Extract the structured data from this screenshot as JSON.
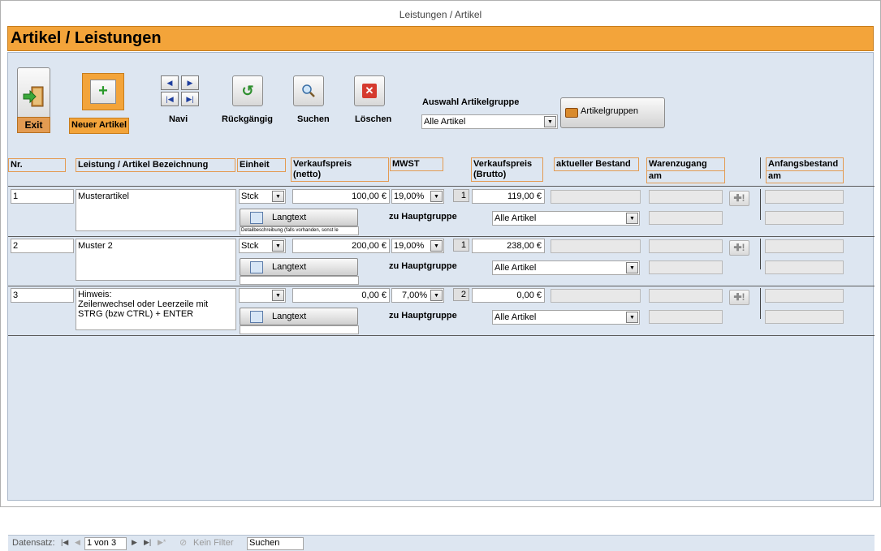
{
  "window_title": "Leistungen / Artikel",
  "header_title": "Artikel / Leistungen",
  "toolbar": {
    "exit": "Exit",
    "new": "Neuer Artikel",
    "navi": "Navi",
    "undo": "Rückgängig",
    "search": "Suchen",
    "delete": "Löschen",
    "group_label": "Auswahl Artikelgruppe",
    "group_value": "Alle Artikel",
    "groups_button": "Artikelgruppen"
  },
  "columns": {
    "nr": "Nr.",
    "name": "Leistung / Artikel Bezeichnung",
    "unit": "Einheit",
    "net1": "Verkaufspreis",
    "net2": "(netto)",
    "vat": "MWST",
    "gross1": "Verkaufspreis",
    "gross2": "(Brutto)",
    "stock": "aktueller Bestand",
    "receipt1": "Warenzugang",
    "receipt2": "am",
    "initial1": "Anfangsbestand",
    "initial2": "am"
  },
  "rows": [
    {
      "nr": "1",
      "name": "Musterartikel",
      "unit": "Stck",
      "net": "100,00 €",
      "vat": "19,00%",
      "vat_code": "1",
      "gross": "119,00 €",
      "langtext": "Langtext",
      "group_label": "zu Hauptgruppe",
      "group": "Alle Artikel",
      "hint": "Detailbeschreibung (falls vorhanden, sonst le"
    },
    {
      "nr": "2",
      "name": "Muster 2",
      "unit": "Stck",
      "net": "200,00 €",
      "vat": "19,00%",
      "vat_code": "1",
      "gross": "238,00 €",
      "langtext": "Langtext",
      "group_label": "zu Hauptgruppe",
      "group": "Alle Artikel",
      "hint": ""
    },
    {
      "nr": "3",
      "name": "Hinweis:\nZeilenwechsel oder Leerzeile mit\nSTRG (bzw CTRL) + ENTER",
      "unit": "",
      "net": "0,00 €",
      "vat": "7,00%",
      "vat_code": "2",
      "gross": "0,00 €",
      "langtext": "Langtext",
      "group_label": "zu Hauptgruppe",
      "group": "Alle Artikel",
      "hint": ""
    }
  ],
  "navbar": {
    "label": "Datensatz:",
    "position": "1 von 3",
    "filter": "Kein Filter",
    "search": "Suchen"
  },
  "colors": {
    "accent": "#f3a43a",
    "form_bg": "#dde6f1"
  }
}
